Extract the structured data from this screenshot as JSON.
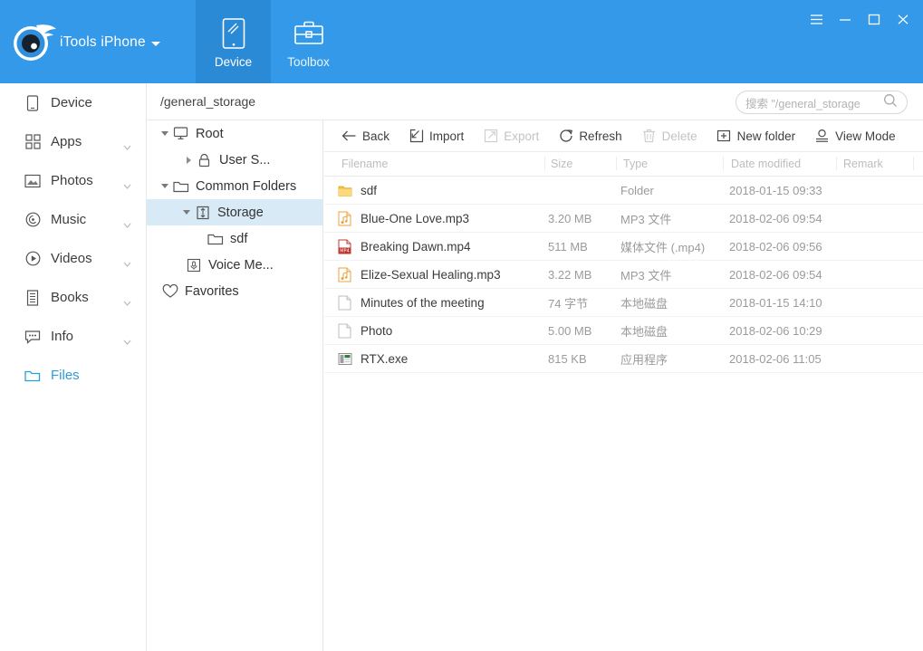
{
  "titlebar": {
    "brand": "iTools iPhone",
    "brand_caret": "chevron-down-icon",
    "tabs": [
      {
        "label": "Device",
        "icon": "tablet-icon",
        "active": true
      },
      {
        "label": "Toolbox",
        "icon": "briefcase-icon",
        "active": false
      }
    ],
    "window_controls": [
      {
        "name": "menu-button",
        "icon": "hamburger-icon"
      },
      {
        "name": "minimize-button",
        "icon": "minimize-icon"
      },
      {
        "name": "maximize-button",
        "icon": "maximize-icon"
      },
      {
        "name": "close-button",
        "icon": "close-icon"
      }
    ],
    "colors": {
      "bg": "#3399e8",
      "tab_active_bg": "#2b8ad6"
    }
  },
  "sidebar": {
    "items": [
      {
        "label": "Device",
        "icon": "phone-icon",
        "chevron": false,
        "selected": false
      },
      {
        "label": "Apps",
        "icon": "grid-icon",
        "chevron": true,
        "selected": false
      },
      {
        "label": "Photos",
        "icon": "image-icon",
        "chevron": true,
        "selected": false
      },
      {
        "label": "Music",
        "icon": "disc-icon",
        "chevron": true,
        "selected": false
      },
      {
        "label": "Videos",
        "icon": "play-icon",
        "chevron": true,
        "selected": false
      },
      {
        "label": "Books",
        "icon": "book-icon",
        "chevron": true,
        "selected": false
      },
      {
        "label": "Info",
        "icon": "chat-icon",
        "chevron": true,
        "selected": false
      },
      {
        "label": "Files",
        "icon": "folder-icon",
        "chevron": false,
        "selected": true
      }
    ],
    "selected_color": "#2d9cdb"
  },
  "tree": {
    "nodes": [
      {
        "label": "Root",
        "icon": "monitor-icon",
        "indent": 0,
        "twisty": "down",
        "selected": false
      },
      {
        "label": "User S...",
        "icon": "lock-icon",
        "indent": 1,
        "twisty": "right",
        "selected": false
      },
      {
        "label": "Common Folders",
        "icon": "folder-icon",
        "indent": 0,
        "twisty": "down",
        "selected": false
      },
      {
        "label": "Storage",
        "icon": "storage-icon",
        "indent": 1,
        "twisty": "down",
        "selected": true
      },
      {
        "label": "sdf",
        "icon": "folder-icon",
        "indent": 2,
        "twisty": "none",
        "selected": false
      },
      {
        "label": "Voice Me...",
        "icon": "microphone-icon",
        "indent": 1,
        "twisty": "none",
        "selected": false
      },
      {
        "label": "Favorites",
        "icon": "heart-icon",
        "indent": 0,
        "twisty": "none",
        "selected": false
      }
    ],
    "selected_bg": "#d9eaf7"
  },
  "pathbar": {
    "path": "/general_storage",
    "search_placeholder": "搜索 \"/general_storage",
    "search_value": "",
    "search_icon": "search-icon"
  },
  "toolbar": {
    "buttons": [
      {
        "label": "Back",
        "icon": "arrow-left-icon",
        "disabled": false
      },
      {
        "label": "Import",
        "icon": "import-icon",
        "disabled": false
      },
      {
        "label": "Export",
        "icon": "export-icon",
        "disabled": true
      },
      {
        "label": "Refresh",
        "icon": "refresh-icon",
        "disabled": false
      },
      {
        "label": "Delete",
        "icon": "trash-icon",
        "disabled": true
      },
      {
        "label": "New folder",
        "icon": "folder-plus-icon",
        "disabled": false
      },
      {
        "label": "View Mode",
        "icon": "view-mode-icon",
        "disabled": false
      }
    ]
  },
  "filetable": {
    "columns": [
      "Filename",
      "Size",
      "Type",
      "Date modified",
      "Remark"
    ],
    "rows": [
      {
        "filename": "sdf",
        "icon": "folder-yellow-icon",
        "size": "",
        "type": "Folder",
        "date": "2018-01-15 09:33",
        "remark": ""
      },
      {
        "filename": "Blue-One Love.mp3",
        "icon": "audio-file-icon",
        "size": "3.20 MB",
        "type": "MP3 文件",
        "date": "2018-02-06 09:54",
        "remark": ""
      },
      {
        "filename": "Breaking Dawn.mp4",
        "icon": "mp4-file-icon",
        "size": "511 MB",
        "type": "媒体文件 (.mp4)",
        "date": "2018-02-06 09:56",
        "remark": ""
      },
      {
        "filename": "Elize-Sexual Healing.mp3",
        "icon": "audio-file-icon",
        "size": "3.22 MB",
        "type": "MP3 文件",
        "date": "2018-02-06 09:54",
        "remark": ""
      },
      {
        "filename": "Minutes of the meeting",
        "icon": "document-icon",
        "size": "74 字节",
        "type": "本地磁盘",
        "date": "2018-01-15 14:10",
        "remark": ""
      },
      {
        "filename": "Photo",
        "icon": "document-icon",
        "size": "5.00 MB",
        "type": "本地磁盘",
        "date": "2018-02-06 10:29",
        "remark": ""
      },
      {
        "filename": "RTX.exe",
        "icon": "exe-file-icon",
        "size": "815 KB",
        "type": "应用程序",
        "date": "2018-02-06 11:05",
        "remark": ""
      }
    ]
  }
}
